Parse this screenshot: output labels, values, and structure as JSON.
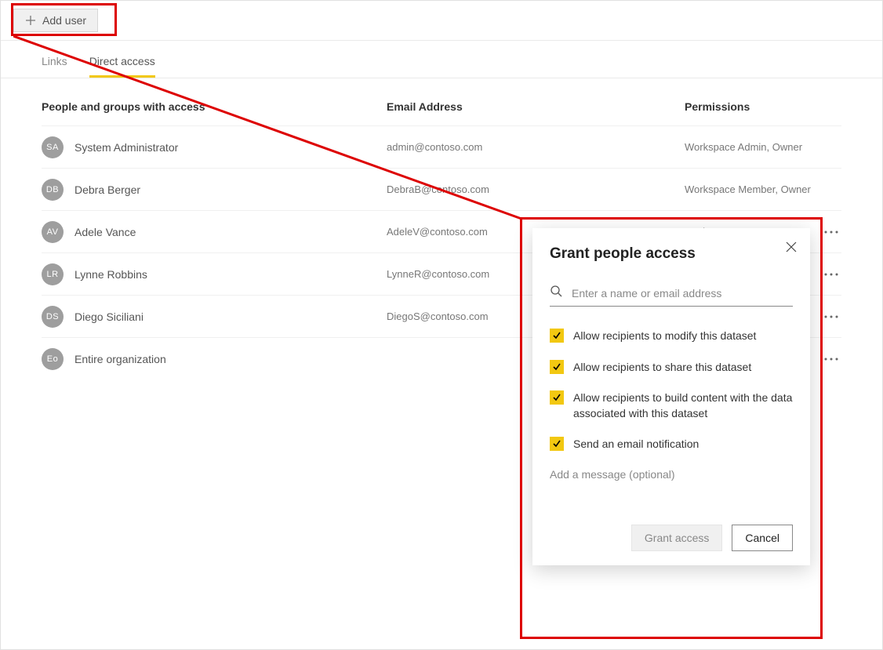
{
  "addUserLabel": "Add user",
  "tabs": {
    "links": "Links",
    "direct": "Direct access"
  },
  "headers": {
    "name": "People and groups with access",
    "email": "Email Address",
    "perm": "Permissions"
  },
  "rows": [
    {
      "initials": "SA",
      "name": "System Administrator",
      "email": "admin@contoso.com",
      "perm": "Workspace Admin, Owner",
      "menu": false
    },
    {
      "initials": "DB",
      "name": "Debra Berger",
      "email": "DebraB@contoso.com",
      "perm": "Workspace Member, Owner",
      "menu": false
    },
    {
      "initials": "AV",
      "name": "Adele Vance",
      "email": "AdeleV@contoso.com",
      "perm": "Reshare",
      "menu": true
    },
    {
      "initials": "LR",
      "name": "Lynne Robbins",
      "email": "LynneR@contoso.com",
      "perm": "",
      "menu": true
    },
    {
      "initials": "DS",
      "name": "Diego Siciliani",
      "email": "DiegoS@contoso.com",
      "perm": "",
      "menu": true
    },
    {
      "initials": "Eo",
      "name": "Entire organization",
      "email": "",
      "perm": "",
      "menu": true
    }
  ],
  "dialog": {
    "title": "Grant people access",
    "searchPlaceholder": "Enter a name or email address",
    "options": {
      "modify": "Allow recipients to modify this dataset",
      "share": "Allow recipients to share this dataset",
      "build": "Allow recipients to build content with the data associated with this dataset",
      "email": "Send an email notification"
    },
    "messagePlaceholder": "Add a message (optional)",
    "grant": "Grant access",
    "cancel": "Cancel"
  }
}
